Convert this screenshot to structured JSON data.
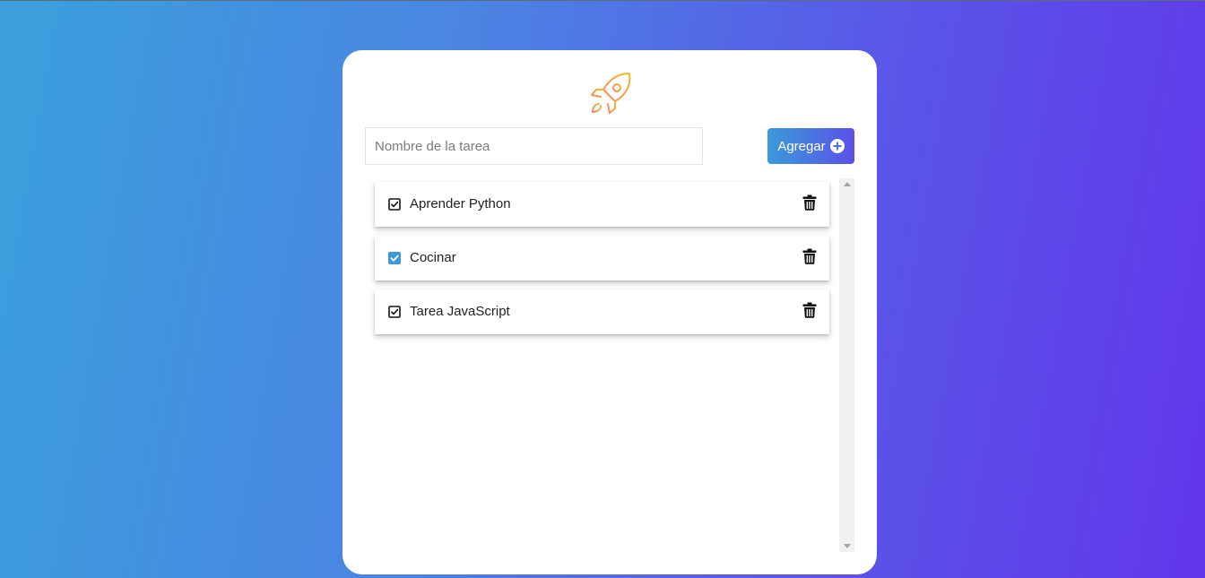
{
  "app": {
    "logo_icon": "rocket-icon",
    "accent_orange": "#f5a623",
    "gradient_start": "#3ba0dc",
    "gradient_end": "#6136ea"
  },
  "form": {
    "input_placeholder": "Nombre de la tarea",
    "input_value": "",
    "add_label": "Agregar",
    "add_icon": "plus-circle-icon"
  },
  "tasks": [
    {
      "label": "Aprender Python",
      "checked": false,
      "check_style": "outline",
      "delete_icon": "trash-icon"
    },
    {
      "label": "Cocinar",
      "checked": true,
      "check_style": "filled",
      "delete_icon": "trash-icon"
    },
    {
      "label": "Tarea JavaScript",
      "checked": false,
      "check_style": "outline",
      "delete_icon": "trash-icon"
    }
  ]
}
